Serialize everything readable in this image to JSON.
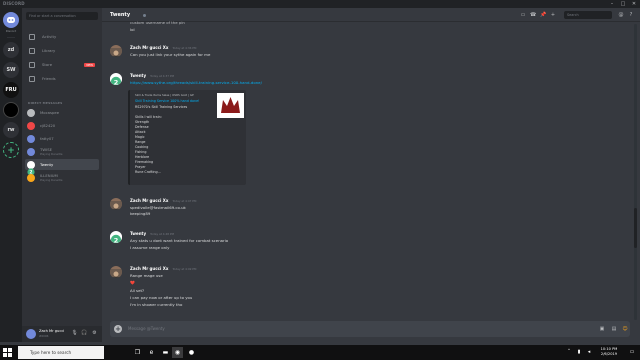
{
  "window": {
    "title": "DISCORD",
    "minimize": "–",
    "maximize": "□",
    "close": "✕"
  },
  "guilds": {
    "home_label": "Discord",
    "items": [
      {
        "label": "zd"
      },
      {
        "label": "SW"
      },
      {
        "label": "FRU"
      },
      {
        "label": "rw"
      }
    ],
    "add": "+"
  },
  "sidebar": {
    "search_placeholder": "Find or start a conversation",
    "nav": [
      {
        "label": "Activity",
        "icon": "activity-icon"
      },
      {
        "label": "Library",
        "icon": "library-icon"
      },
      {
        "label": "Store",
        "icon": "store-icon",
        "badge": "NEW"
      },
      {
        "label": "Friends",
        "icon": "friends-icon"
      }
    ],
    "dm_header": "DIRECT MESSAGES",
    "dms": [
      {
        "name": "Mocaspee",
        "sub": "",
        "color": "#b9bbbe"
      },
      {
        "name": "cj82420",
        "sub": "",
        "color": "#f04747"
      },
      {
        "name": "fatty07",
        "sub": "",
        "color": "#7289da"
      },
      {
        "name": "TWISE",
        "sub": "Playing Runelite",
        "color": "#7289da"
      },
      {
        "name": "Twenty",
        "sub": "",
        "color": "#43b581"
      },
      {
        "name": "ILLENIUM",
        "sub": "Playing Runelite",
        "color": "#faa61a"
      }
    ],
    "user": {
      "name": "Zach Mr gucci",
      "tag": "#6096",
      "mic": "🎙",
      "headphones": "🎧",
      "settings": "⚙"
    }
  },
  "chat": {
    "title": "Twenty",
    "search_placeholder": "Search",
    "help": "?",
    "messages": [
      {
        "type": "continuation",
        "lines": [
          "custom username of the pin",
          "lol"
        ]
      },
      {
        "type": "group",
        "author": "Zach Mr gucci Xx",
        "timestamp": "Today at 4:36 PM",
        "avatar": "zach",
        "lines": [
          "Can you just link your sythe again for me"
        ]
      },
      {
        "type": "group",
        "author": "Twenty",
        "timestamp": "Today at 4:37 PM",
        "avatar": "twenty",
        "lines": [
          "https://www.sythe.org/threads/skill-training-service-100-hand-done/"
        ],
        "embed": {
          "provider": "Skill & Trade Items Sales | OSRS Gold | GP",
          "title": "Skill Training Service 100% hand done!",
          "lines": [
            "RS2970's Skill Training Services",
            "",
            "Skills I will train:",
            "Strength",
            "Defense",
            "Attack",
            "Magic",
            "Range",
            "Cooking",
            "Fishing",
            "Herblore",
            "Firemaking",
            "Prayer",
            "Rune Crafting..."
          ]
        }
      },
      {
        "type": "group",
        "author": "Zach Mr gucci Xx",
        "timestamp": "Today at 4:47 PM",
        "avatar": "zach",
        "lines": [
          "spedivolle@fastmail69.co.uk",
          "keeping89"
        ]
      },
      {
        "type": "group",
        "author": "Twenty",
        "timestamp": "Today at 4:48 PM",
        "avatar": "twenty",
        "lines": [
          "Any stats u dont want trained for combat scenario",
          "I assume range only"
        ]
      },
      {
        "type": "group",
        "author": "Zach Mr gucci Xx",
        "timestamp": "Today at 4:49 PM",
        "avatar": "zach",
        "lines": [
          "Range mage use",
          "❤️",
          "All set?",
          "I can pay now or after up to you",
          "I'm in shower currently tho"
        ]
      }
    ],
    "composer_placeholder": "Message @Twenty"
  },
  "taskbar": {
    "search_placeholder": "Type here to search",
    "time": "10:10 PM",
    "date": "2/6/2019"
  }
}
